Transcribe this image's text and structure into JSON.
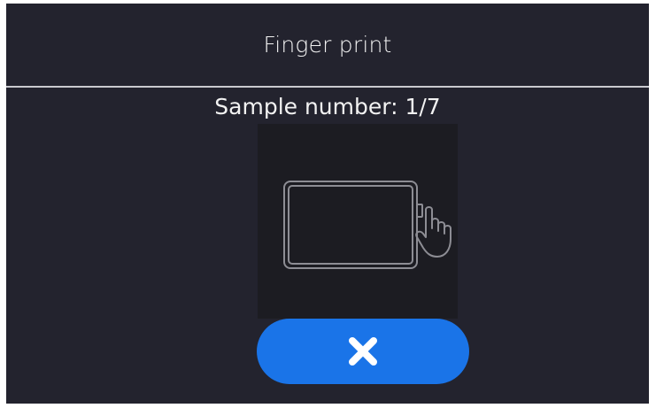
{
  "header": {
    "title": "Finger print"
  },
  "main": {
    "sample_label": "Sample number: 1/7",
    "illustration_icon": "hand-on-scanner-icon"
  },
  "actions": {
    "cancel_icon": "close-icon",
    "cancel_color": "#1a74e8"
  },
  "colors": {
    "background": "#23232e",
    "panel": "#1c1c22",
    "text": "#f2f2f2",
    "divider": "#c9c9cf"
  }
}
